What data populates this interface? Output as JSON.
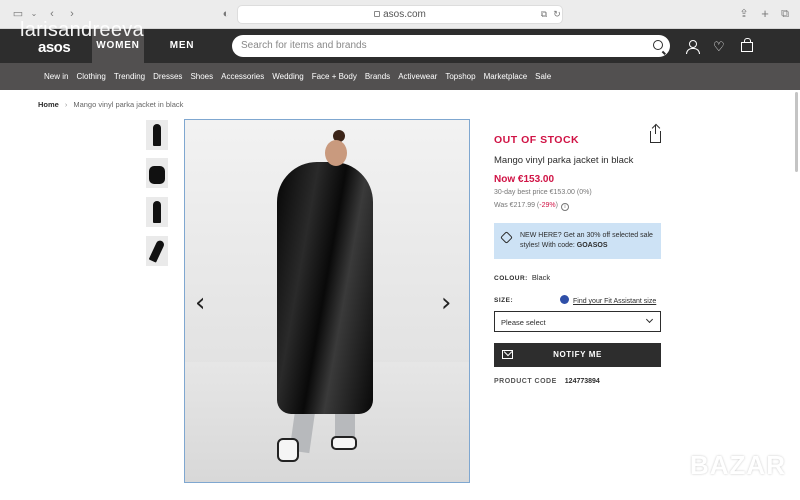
{
  "browser": {
    "url": "asos.com",
    "icons": [
      "sidebar-icon",
      "chevron-down-icon",
      "back-icon",
      "forward-icon",
      "shield-icon",
      "translate-icon",
      "reload-icon",
      "share-icon",
      "plus-icon",
      "tabs-icon"
    ]
  },
  "header": {
    "logo": "asos",
    "women": "WOMEN",
    "men": "MEN",
    "search_placeholder": "Search for items and brands"
  },
  "nav": [
    "New in",
    "Clothing",
    "Trending",
    "Dresses",
    "Shoes",
    "Accessories",
    "Wedding",
    "Face + Body",
    "Brands",
    "Activewear",
    "Topshop",
    "Marketplace",
    "Sale"
  ],
  "breadcrumb": {
    "home": "Home",
    "separator": "›",
    "current": "Mango vinyl parka jacket in black"
  },
  "product": {
    "status": "OUT OF STOCK",
    "name": "Mango vinyl parka jacket in black",
    "price_now": "Now €153.00",
    "best_price": "30-day best price €153.00 (0%)",
    "was_price": "Was €217.99 (",
    "was_discount": "-29%",
    "was_close": ")",
    "info_icon": "i",
    "promo_text": "NEW HERE? Get an 30% off selected sale styles! With code: ",
    "promo_code": "GOASOS",
    "colour_label": "COLOUR:",
    "colour_value": "Black",
    "size_label": "SIZE:",
    "fit_link": "Find your Fit Assistant size",
    "size_select": "Please select",
    "notify_label": "NOTIFY ME",
    "code_label": "PRODUCT CODE",
    "code_value": "124773894"
  },
  "gallery": {
    "prev": "‹",
    "next": "›"
  },
  "watermarks": {
    "top": "larisandreeva",
    "bottom": "BAZAR"
  },
  "colors": {
    "header_bg": "#2d2d2d",
    "nav_bg": "#525050",
    "accent_red": "#d01345",
    "promo_bg": "#cde2f5"
  }
}
